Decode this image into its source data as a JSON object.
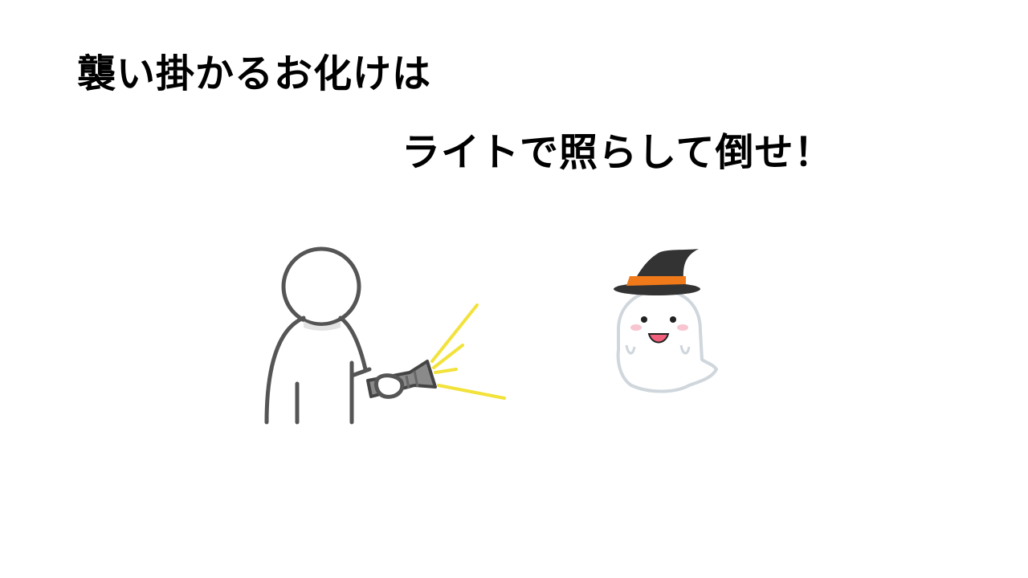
{
  "title": {
    "line1": "襲い掛かるお化けは",
    "line2": "ライトで照らして倒せ！"
  },
  "colors": {
    "outline": "#555555",
    "light_beam": "#f2e23a",
    "ghost_hat": "#333333",
    "hat_band": "#f07a1a",
    "ghost_body": "#ffffff",
    "ghost_outline": "#cfd6dc",
    "cheek": "#f7c6d0"
  }
}
